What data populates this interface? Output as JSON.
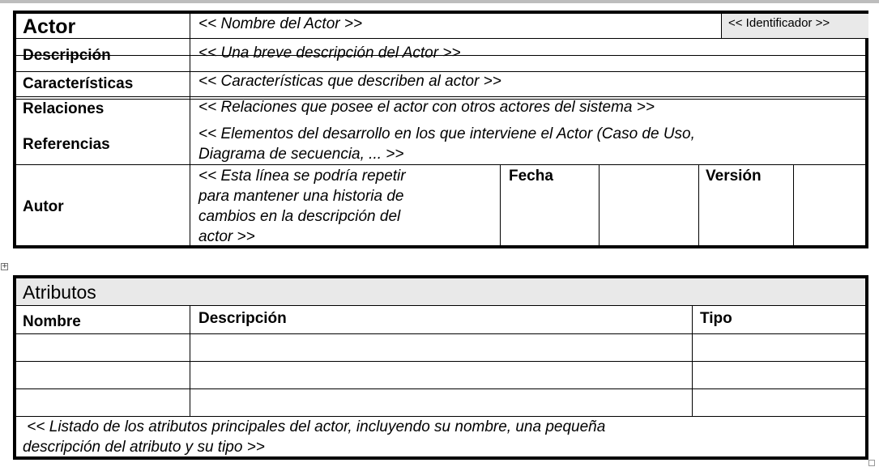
{
  "actor_table": {
    "actor_label": "Actor",
    "actor_name": "<< Nombre del Actor >>",
    "identifier": "<< Identificador >>",
    "description_label": "Descripción",
    "description_value": "<< Una breve descripción del Actor >>",
    "characteristics_label": "Características",
    "characteristics_value": "<< Características que describen al actor >>",
    "relations_label": "Relaciones",
    "relations_value": "<< Relaciones que posee el actor con otros actores del sistema >>",
    "references_label": "Referencias",
    "references_value_line1": "<< Elementos del desarrollo en los que interviene el Actor (Caso de Uso,",
    "references_value_line2": "Diagrama de secuencia, ... >>",
    "author_label": "Autor",
    "author_note_lines": [
      "<< Esta línea se podría repetir",
      "para mantener una historia de",
      "cambios en la descripción del",
      "actor >>"
    ],
    "date_label": "Fecha",
    "version_label": "Versión"
  },
  "attributes_table": {
    "title": "Atributos",
    "columns": [
      "Nombre",
      "Descripción",
      "Tipo"
    ],
    "rows": [
      [
        "",
        "",
        ""
      ],
      [
        "",
        "",
        ""
      ],
      [
        "",
        "",
        ""
      ]
    ],
    "footer_line1": " << Listado de los atributos principales del actor, incluyendo su nombre, una pequeña",
    "footer_line2": "descripción del atributo y su tipo >>"
  }
}
